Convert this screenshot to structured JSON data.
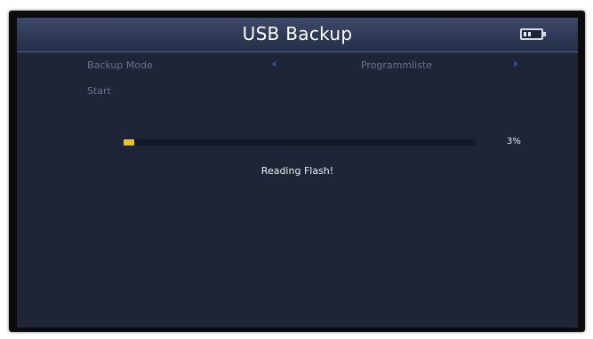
{
  "screen": {
    "title": "USB Backup",
    "battery_icon": "battery-icon"
  },
  "menu": {
    "backup_mode_label": "Backup Mode",
    "backup_mode_value": "Programmliste",
    "left_arrow": "‹",
    "right_arrow": "›",
    "start_label": "Start"
  },
  "progress": {
    "value": 0.03,
    "percent_text": "3%",
    "status_text": "Reading Flash!"
  },
  "colors": {
    "background": "#1f2537",
    "title_bar": "#2e3955",
    "accent_arrow": "#3e6be0",
    "progress_fill": "#e9c229"
  }
}
